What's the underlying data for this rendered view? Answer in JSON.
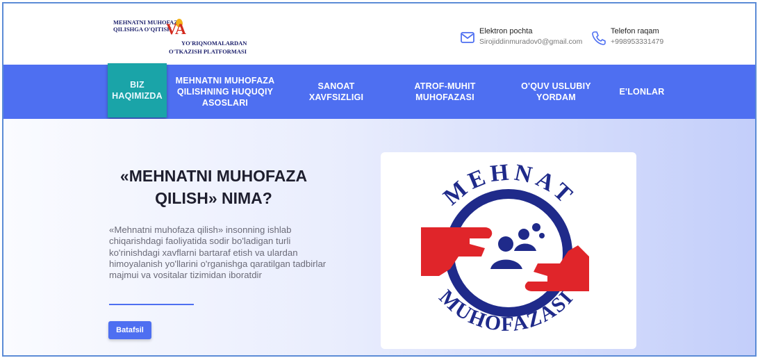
{
  "brand": {
    "line1": "MEHNATNI MUHOFAZA",
    "line2": "QILISHGA O'QITISH",
    "va": "VA",
    "line3": "YO'RIQNOMALARDAN",
    "line4": "O'TKAZISH PLATFORMASI"
  },
  "contacts": {
    "email_label": "Elektron pochta",
    "email_value": "Sirojiddinmuradov0@gmail.com",
    "phone_label": "Telefon raqam",
    "phone_value": "+998953331479",
    "icons": [
      "mail-icon",
      "phone-icon"
    ]
  },
  "nav": {
    "items": [
      {
        "label": "BIZ HAQIMIZDA"
      },
      {
        "label": "MEHNATNI MUHOFAZA QILISHNING HUQUQIY ASOSLARI"
      },
      {
        "label": "SANOAT XAVFSIZLIGI"
      },
      {
        "label": "ATROF-MUHIT MUHOFAZASI"
      },
      {
        "label": "O'QUV USLUBIY YORDAM"
      },
      {
        "label": "E'LONLAR"
      }
    ]
  },
  "hero": {
    "title": "«MEHNATNI MUHOFAZA QILISH» NIMA?",
    "text": "«Mehnatni muhofaza qilish» insonning ishlab chiqarishdagi faoliyatida sodir bo'ladigan turli ko'rinishdagi xavflarni bartaraf etish va ulardan himoyalanish yo'llarini o'rganishga qaratilgan tadbirlar majmui va vositalar tizimidan iboratdir",
    "button": "Batafsil"
  },
  "emblem": {
    "top_text": "MEHNAT",
    "bottom_text": "MUHOFAZASI"
  },
  "colors": {
    "nav": "#4e6ff1",
    "nav_active": "#1aa4a8",
    "emblem_blue": "#1f2a8a",
    "emblem_red": "#e0252a"
  }
}
